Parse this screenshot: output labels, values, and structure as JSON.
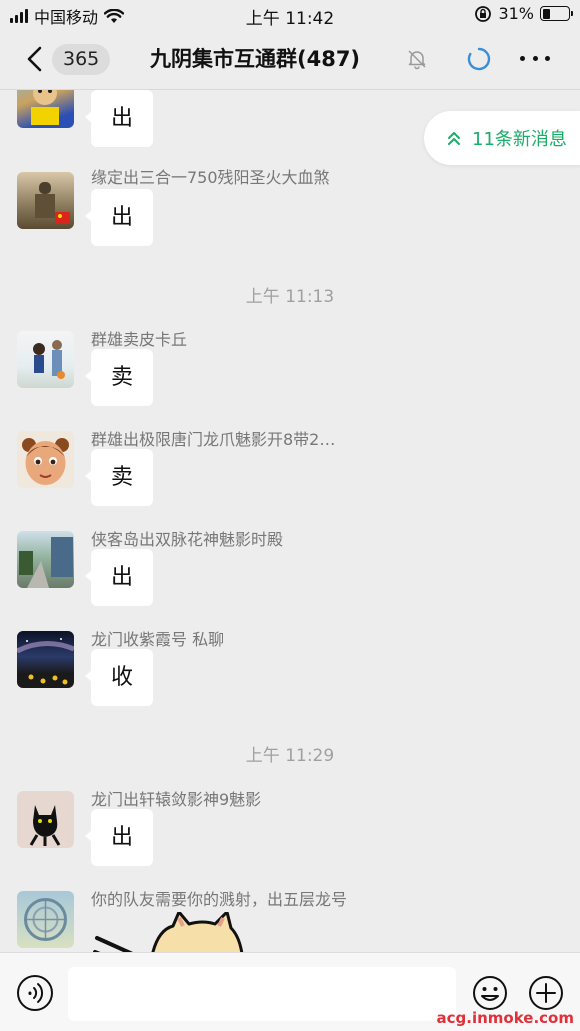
{
  "status_bar": {
    "carrier": "中国移动",
    "time": "上午 11:42",
    "battery": "31%",
    "battery_level": 0.31
  },
  "nav": {
    "unread_count": "365",
    "title": "九阴集市互通群(487)"
  },
  "new_messages_pill": "11条新消息",
  "timestamps": [
    "上午 11:13",
    "上午 11:29"
  ],
  "messages": [
    {
      "sender": "",
      "text": "出"
    },
    {
      "sender": "缘定出三合一750残阳圣火大血煞",
      "text": "出"
    },
    {
      "sender": "群雄卖皮卡丘",
      "text": "卖"
    },
    {
      "sender": "群雄出极限唐门龙爪魅影开8带2…",
      "text": "卖"
    },
    {
      "sender": "侠客岛出双脉花神魅影时殿",
      "text": "出"
    },
    {
      "sender": "龙门收紫霞号 私聊",
      "text": "收"
    },
    {
      "sender": "龙门出轩辕敛影神9魅影",
      "text": "出"
    },
    {
      "sender": "你的队友需要你的溅射，出五层龙号",
      "text": ""
    }
  ],
  "input_bar": {
    "placeholder": ""
  },
  "watermark": "acg.inmoke.com",
  "colors": {
    "background": "#ededed",
    "accent_green": "#1aad6a",
    "timestamp_gray": "#a0a0a0"
  }
}
